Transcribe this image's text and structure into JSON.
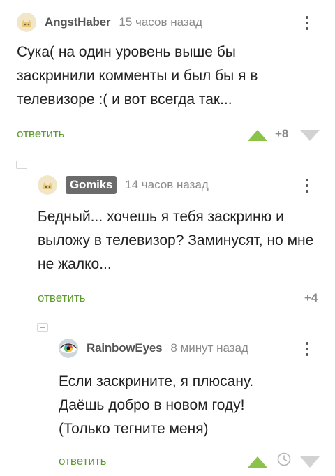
{
  "comments": [
    {
      "author": "AngstHaber",
      "time": "15 часов назад",
      "text": "Сука( на один уровень выше бы заскринили комменты и был бы я в телевизоре :( и вот всегда так...",
      "reply_label": "ответить",
      "rating": "+8",
      "avatar_icon": "cat-avatar-icon"
    },
    {
      "author": "Gomiks",
      "time": "14 часов назад",
      "text": "Бедный... хочешь я тебя заскриню и выложу в телевизор? Заминусят, но мне не жалко...",
      "reply_label": "ответить",
      "rating": "+4",
      "avatar_icon": "cat-avatar-icon"
    },
    {
      "author": "RainbowEyes",
      "time": "8 минут назад",
      "text_lines": [
        "Если заскрините, я плюсану.",
        "Даёшь добро в новом году!",
        "(Только тегните меня)"
      ],
      "reply_label": "ответить",
      "avatar_icon": "rainbow-eye-avatar-icon"
    }
  ],
  "colors": {
    "accent_green": "#5d9b2e",
    "vote_up": "#8bc34a",
    "vote_down": "#d2d2d2",
    "badge_bg": "#6b6b6b"
  }
}
